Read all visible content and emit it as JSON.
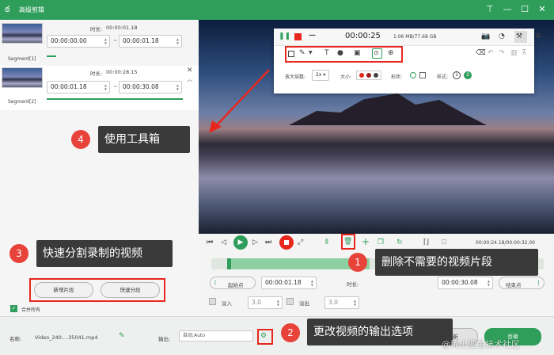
{
  "window": {
    "title": "高级剪辑",
    "pin": "⊤",
    "minimize": "—",
    "maximize": "☐",
    "close": "✕"
  },
  "segments": [
    {
      "label": "Segment[1]",
      "duration_label": "时长:",
      "duration": "00:00:01.18",
      "start": "00:00:00.00",
      "end": "00:00:01.18",
      "dash": "~"
    },
    {
      "label": "Segment[2]",
      "duration_label": "时长:",
      "duration": "00:00:28.15",
      "start": "00:00:01.18",
      "end": "00:00:30.08",
      "dash": "~"
    }
  ],
  "toolbox": {
    "time": "00:00:25",
    "size": "1.06 MB/77.68 GB",
    "zoom_label": "放大倍数:",
    "zoom_value": "2x",
    "size_label": "大小:",
    "shape_label": "形状:",
    "style_label": "样式:",
    "style_values": [
      "1",
      "2"
    ]
  },
  "playback": {
    "time": "00:00:24.18/00:00:32.00"
  },
  "trim": {
    "start_button": "起始点",
    "start_time": "00:00:01.18",
    "duration_label": "时长:",
    "end_time": "00:00:30.08",
    "end_button": "结束点"
  },
  "fade": {
    "fade_in_label": "淡入",
    "fade_in_value": "3.0",
    "fade_out_label": "淡出",
    "fade_out_value": "3.0"
  },
  "buttons": {
    "new_segment": "新增片段",
    "quick_split": "快速分段",
    "merge_all": "合并所有",
    "export": "剪辑",
    "cancel": "重新"
  },
  "bottom": {
    "name_label": "名称:",
    "name_value": "Video_240....35041.mp4",
    "output_label": "输出:",
    "output_value": "自动;Auto"
  },
  "callouts": [
    {
      "num": "1",
      "text": "删除不需要的视频片段"
    },
    {
      "num": "2",
      "text": "更改视频的输出选项"
    },
    {
      "num": "3",
      "text": "快速分割录制的视频"
    },
    {
      "num": "4",
      "text": "使用工具箱"
    }
  ],
  "watermark": "@稀土掘金技术社区",
  "colors": {
    "brand": "#2f9e5b",
    "callout_red": "#e8433b",
    "callout_bg": "#3a3a3a"
  }
}
